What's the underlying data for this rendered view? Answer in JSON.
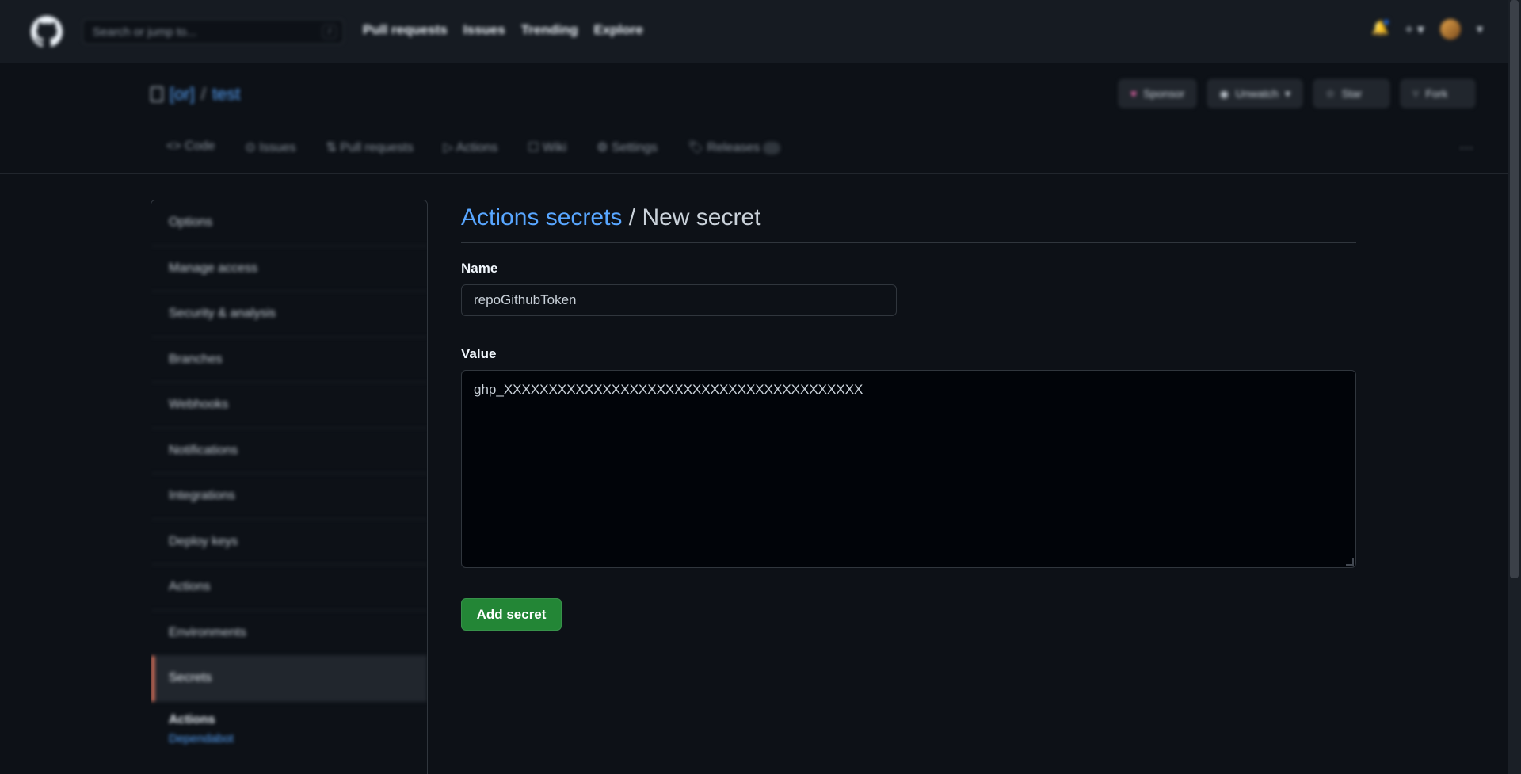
{
  "header": {
    "search_placeholder": "Search or jump to...",
    "search_shortcut": "/",
    "nav": [
      "Pull requests",
      "Issues",
      "Trending",
      "Explore"
    ]
  },
  "repo": {
    "owner": "[or]",
    "name": "test",
    "actions": {
      "sponsor": "Sponsor",
      "unwatch": "Unwatch",
      "star": "Star",
      "fork": "Fork"
    }
  },
  "tabs": [
    "Code",
    "Issues",
    "Pull requests",
    "Actions",
    "Wiki",
    "Settings",
    "Releases"
  ],
  "sidebar": {
    "items": [
      "Options",
      "Manage access",
      "Security & analysis",
      "Branches",
      "Webhooks",
      "Notifications",
      "Integrations",
      "Deploy keys",
      "Actions",
      "Environments",
      "Secrets"
    ],
    "selected": "Secrets",
    "section_title": "Actions",
    "section_link": "Dependabot"
  },
  "page": {
    "breadcrumb": "Actions secrets",
    "title_sep": "/",
    "title": "New secret",
    "name_label": "Name",
    "name_value": "repoGithubToken",
    "value_label": "Value",
    "value_value": "ghp_XXXXXXXXXXXXXXXXXXXXXXXXXXXXXXXXXXXXXXXX",
    "submit_label": "Add secret"
  },
  "colors": {
    "background": "#0d1117",
    "link": "#58a6ff",
    "primary_button": "#238636",
    "selected_indicator": "#f78166"
  }
}
